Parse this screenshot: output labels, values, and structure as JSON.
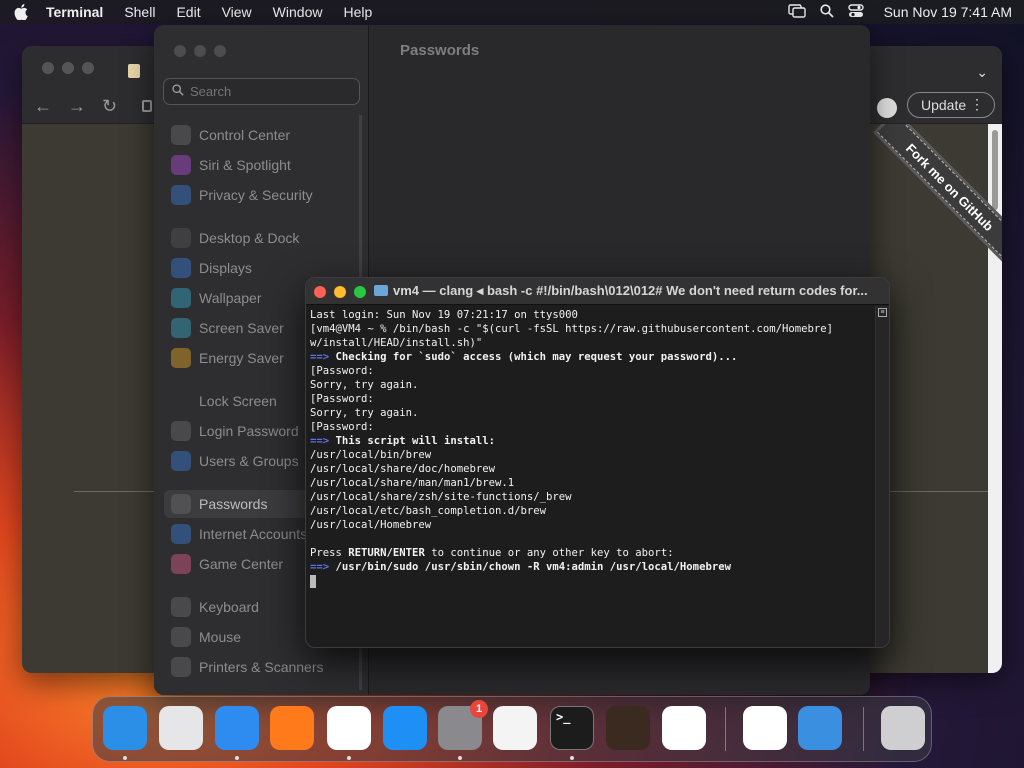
{
  "menubar": {
    "app_name": "Terminal",
    "menus": [
      "Shell",
      "Edit",
      "View",
      "Window",
      "Help"
    ],
    "clock": "Sun Nov 19  7:41 AM"
  },
  "browser": {
    "update_label": "Update",
    "ribbon_text": "Fork me on GitHub"
  },
  "settings": {
    "search_placeholder": "Search",
    "title": "Passwords",
    "items": [
      {
        "label": "Control Center",
        "icon": "control-center-icon",
        "color": "#6b6b6e"
      },
      {
        "label": "Siri & Spotlight",
        "icon": "siri-icon",
        "color": "#b04bd8"
      },
      {
        "label": "Privacy & Security",
        "icon": "hand-icon",
        "color": "#3a7bd5"
      },
      {
        "label": "Desktop & Dock",
        "icon": "dock-icon",
        "color": "#555558"
      },
      {
        "label": "Displays",
        "icon": "sun-icon",
        "color": "#3a7bd5"
      },
      {
        "label": "Wallpaper",
        "icon": "wallpaper-icon",
        "color": "#35a6c9"
      },
      {
        "label": "Screen Saver",
        "icon": "screen-saver-icon",
        "color": "#3aa6c0"
      },
      {
        "label": "Energy Saver",
        "icon": "bulb-icon",
        "color": "#e0a623"
      },
      {
        "label": "Lock Screen",
        "icon": "lock-icon",
        "color": "#2e2e30"
      },
      {
        "label": "Login Password",
        "icon": "key-icon",
        "color": "#6b6b6e"
      },
      {
        "label": "Users & Groups",
        "icon": "users-icon",
        "color": "#3a7bd5"
      },
      {
        "label": "Passwords",
        "icon": "key-icon",
        "color": "#6b6b6e"
      },
      {
        "label": "Internet Accounts",
        "icon": "at-icon",
        "color": "#3a7bd5"
      },
      {
        "label": "Game Center",
        "icon": "game-center-icon",
        "color": "#d95a8a"
      },
      {
        "label": "Keyboard",
        "icon": "keyboard-icon",
        "color": "#6b6b6e"
      },
      {
        "label": "Mouse",
        "icon": "mouse-icon",
        "color": "#6b6b6e"
      },
      {
        "label": "Printers & Scanners",
        "icon": "printer-icon",
        "color": "#6b6b6e"
      }
    ],
    "selected": "Passwords"
  },
  "terminal": {
    "title": "vm4 — clang ◂ bash -c #!/bin/bash\\012\\012# We don't need return codes for...",
    "lines": [
      {
        "text": "Last login: Sun Nov 19 07:21:17 on ttys000"
      },
      {
        "text": "[vm4@VM4 ~ % /bin/bash -c \"$(curl -fsSL https://raw.githubusercontent.com/Homebre]"
      },
      {
        "text": "w/install/HEAD/install.sh)\""
      },
      {
        "arrow": "==>",
        "bold": " Checking for `sudo` access (which may request your password)..."
      },
      {
        "text": "[Password:",
        "rb": "]"
      },
      {
        "text": "Sorry, try again."
      },
      {
        "text": "[Password:",
        "rb": "]"
      },
      {
        "text": "Sorry, try again."
      },
      {
        "text": "[Password:",
        "rb": "]"
      },
      {
        "arrow": "==>",
        "bold": " This script will install:"
      },
      {
        "text": "/usr/local/bin/brew"
      },
      {
        "text": "/usr/local/share/doc/homebrew"
      },
      {
        "text": "/usr/local/share/man/man1/brew.1"
      },
      {
        "text": "/usr/local/share/zsh/site-functions/_brew"
      },
      {
        "text": "/usr/local/etc/bash_completion.d/brew"
      },
      {
        "text": "/usr/local/Homebrew"
      },
      {
        "text": ""
      },
      {
        "pre": "Press ",
        "boldmid": "RETURN/ENTER",
        "post": " to continue or any other key to abort:"
      },
      {
        "arrow": "==>",
        "bold": " /usr/bin/sudo /usr/sbin/chown -R vm4:admin /usr/local/Homebrew"
      },
      {
        "cursor": true
      }
    ]
  },
  "dock": {
    "apps": [
      {
        "name": "finder-icon",
        "label": "Finder",
        "color": "#2b8fe8",
        "running": true
      },
      {
        "name": "launchpad-icon",
        "label": "Launchpad",
        "color": "#e6e6e8",
        "running": false
      },
      {
        "name": "safari-icon",
        "label": "Safari",
        "color": "#2e8cf0",
        "running": true
      },
      {
        "name": "firefox-icon",
        "label": "Firefox",
        "color": "#ff7a1a",
        "running": false
      },
      {
        "name": "chrome-icon",
        "label": "Chrome",
        "color": "#ffffff",
        "running": true
      },
      {
        "name": "app-store-icon",
        "label": "App Store",
        "color": "#1e8ff5",
        "running": false
      },
      {
        "name": "system-settings-icon",
        "label": "System Settings",
        "color": "#8a8a8e",
        "running": true,
        "badge": "1"
      },
      {
        "name": "textedit-icon",
        "label": "TextEdit",
        "color": "#f4f4f4",
        "running": false
      },
      {
        "name": "terminal-icon",
        "label": "Terminal",
        "color": "#1c1c1c",
        "running": true
      },
      {
        "name": "garageband-icon",
        "label": "GarageBand",
        "color": "#3a2a20",
        "running": false
      },
      {
        "name": "vscode-icon",
        "label": "VS Code",
        "color": "#ffffff",
        "running": false
      },
      {
        "name": "visual-studio-icon",
        "label": "Visual Studio",
        "color": "#ffffff",
        "running": false
      },
      {
        "name": "weather-icon",
        "label": "Weather",
        "color": "#3b8fe0",
        "running": false
      },
      {
        "name": "trash-icon",
        "label": "Trash",
        "color": "#cfcfd2",
        "running": false
      }
    ]
  }
}
